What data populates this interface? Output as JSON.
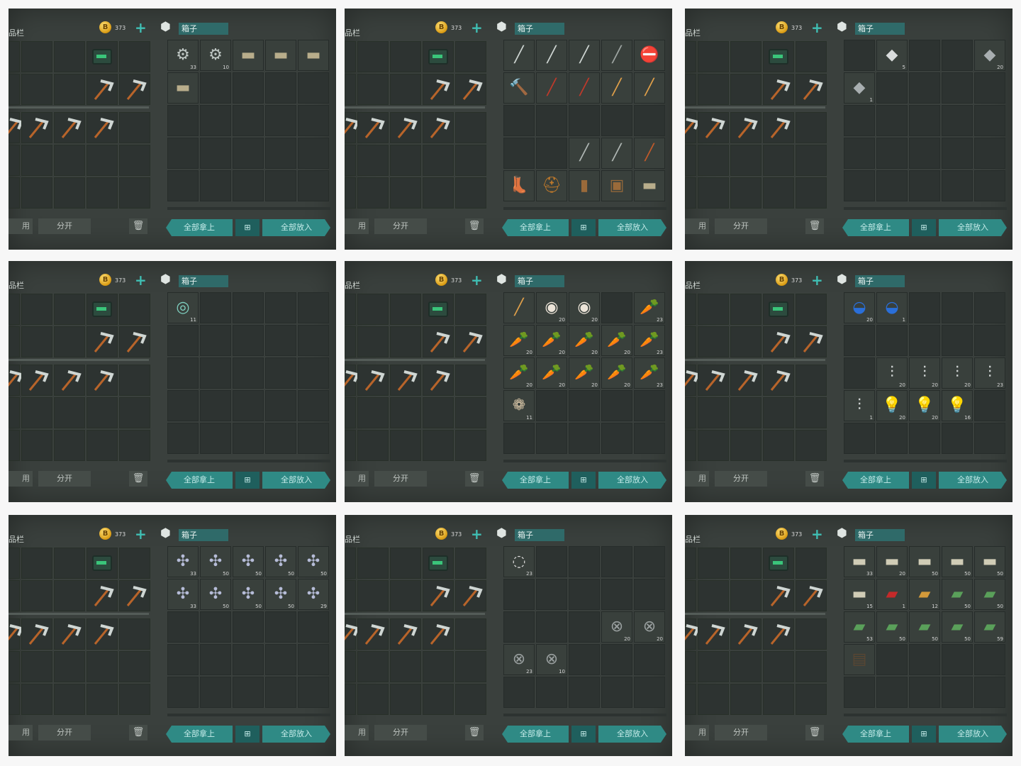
{
  "labels": {
    "inventory": "品栏",
    "coins": "373",
    "split": "分开",
    "use": "用",
    "box": "箱子",
    "take_all": "全部拿上",
    "put_all": "全部放入",
    "sort": "⊞",
    "trash": "🗑",
    "plus": "+"
  },
  "colors": {
    "accent": "#2f8a85",
    "panel": "#3a403d",
    "slot": "#2d3331"
  },
  "panels": [
    {
      "name": "box-tools",
      "slots": [
        {
          "icon": "⚙",
          "c": "#bfc7c4",
          "n": "33"
        },
        {
          "icon": "⚙",
          "c": "#bfc7c4",
          "n": "10"
        },
        {
          "icon": "▬",
          "c": "#b8ad8b",
          "n": ""
        },
        {
          "icon": "▬",
          "c": "#b8ad8b",
          "n": ""
        },
        {
          "icon": "▬",
          "c": "#b8ad8b",
          "n": ""
        },
        {
          "icon": "▬",
          "c": "#b8ad8b",
          "n": ""
        }
      ]
    },
    {
      "name": "box-weapons",
      "slots": [
        {
          "icon": "╱",
          "c": "#cfd6d3",
          "n": ""
        },
        {
          "icon": "╱",
          "c": "#cfd6d3",
          "n": ""
        },
        {
          "icon": "╱",
          "c": "#cfd6d3",
          "n": ""
        },
        {
          "icon": "╱",
          "c": "#9fa6a3",
          "n": ""
        },
        {
          "icon": "⛔",
          "c": "#d33",
          "n": ""
        },
        {
          "icon": "🔨",
          "c": "#4a90d9",
          "n": ""
        },
        {
          "icon": "╱",
          "c": "#c0392b",
          "n": ""
        },
        {
          "icon": "╱",
          "c": "#c0392b",
          "n": ""
        },
        {
          "icon": "╱",
          "c": "#e0a04a",
          "n": ""
        },
        {
          "icon": "╱",
          "c": "#e0a04a",
          "n": ""
        },
        {
          "icon": "",
          "c": "",
          "n": ""
        },
        {
          "icon": "",
          "c": "",
          "n": ""
        },
        {
          "icon": "",
          "c": "",
          "n": ""
        },
        {
          "icon": "",
          "c": "",
          "n": ""
        },
        {
          "icon": "",
          "c": "",
          "n": ""
        },
        {
          "icon": "",
          "c": "",
          "n": ""
        },
        {
          "icon": "",
          "c": "",
          "n": ""
        },
        {
          "icon": "╱",
          "c": "#b0b7b4",
          "n": ""
        },
        {
          "icon": "╱",
          "c": "#b0b7b4",
          "n": ""
        },
        {
          "icon": "╱",
          "c": "#c25a2a",
          "n": ""
        },
        {
          "icon": "👢",
          "c": "#b86a2a",
          "n": ""
        },
        {
          "icon": "⛑",
          "c": "#c27a2a",
          "n": ""
        },
        {
          "icon": "▮",
          "c": "#9a6a3a",
          "n": ""
        },
        {
          "icon": "▣",
          "c": "#9a6a3a",
          "n": ""
        },
        {
          "icon": "▬",
          "c": "#b8ad8b",
          "n": ""
        }
      ]
    },
    {
      "name": "box-metal",
      "slots": [
        {
          "icon": "",
          "c": "",
          "n": ""
        },
        {
          "icon": "◆",
          "c": "#d9dcdc",
          "n": "5"
        },
        {
          "icon": "",
          "c": "",
          "n": ""
        },
        {
          "icon": "",
          "c": "",
          "n": ""
        },
        {
          "icon": "◆",
          "c": "#a8aeb0",
          "n": "20"
        },
        {
          "icon": "◆",
          "c": "#a8aeb0",
          "n": "1"
        }
      ]
    },
    {
      "name": "box-wire",
      "slots": [
        {
          "icon": "◎",
          "c": "#7fd0c0",
          "n": "11"
        }
      ]
    },
    {
      "name": "box-carrots",
      "slots": [
        {
          "icon": "╱",
          "c": "#e0a04a",
          "n": ""
        },
        {
          "icon": "◉",
          "c": "#ece4d8",
          "n": "20"
        },
        {
          "icon": "◉",
          "c": "#ece4d8",
          "n": "20"
        },
        {
          "icon": "",
          "c": "",
          "n": ""
        },
        {
          "icon": "🥕",
          "c": "#e8742a",
          "n": "23"
        },
        {
          "icon": "🥕",
          "c": "#e8742a",
          "n": "20"
        },
        {
          "icon": "🥕",
          "c": "#e8742a",
          "n": "20"
        },
        {
          "icon": "🥕",
          "c": "#e8742a",
          "n": "20"
        },
        {
          "icon": "🥕",
          "c": "#e8742a",
          "n": "20"
        },
        {
          "icon": "🥕",
          "c": "#e8742a",
          "n": "23"
        },
        {
          "icon": "🥕",
          "c": "#e8742a",
          "n": "20"
        },
        {
          "icon": "🥕",
          "c": "#e8742a",
          "n": "20"
        },
        {
          "icon": "🥕",
          "c": "#e8742a",
          "n": "20"
        },
        {
          "icon": "🥕",
          "c": "#e8742a",
          "n": "20"
        },
        {
          "icon": "🥕",
          "c": "#e8742a",
          "n": "23"
        },
        {
          "icon": "❁",
          "c": "#d9c6a8",
          "n": "11"
        }
      ]
    },
    {
      "name": "box-electronics",
      "slots": [
        {
          "icon": "◒",
          "c": "#2a6fd9",
          "n": "20"
        },
        {
          "icon": "◒",
          "c": "#2a6fd9",
          "n": "1"
        },
        {
          "icon": "",
          "c": "",
          "n": ""
        },
        {
          "icon": "",
          "c": "",
          "n": ""
        },
        {
          "icon": "",
          "c": "",
          "n": ""
        },
        {
          "icon": "",
          "c": "",
          "n": ""
        },
        {
          "icon": "",
          "c": "",
          "n": ""
        },
        {
          "icon": "",
          "c": "",
          "n": ""
        },
        {
          "icon": "",
          "c": "",
          "n": ""
        },
        {
          "icon": "",
          "c": "",
          "n": ""
        },
        {
          "icon": "",
          "c": "",
          "n": ""
        },
        {
          "icon": "⫶",
          "c": "#cfd3d3",
          "n": "20"
        },
        {
          "icon": "⫶",
          "c": "#cfd3d3",
          "n": "20"
        },
        {
          "icon": "⫶",
          "c": "#cfd3d3",
          "n": "20"
        },
        {
          "icon": "⫶",
          "c": "#cfd3d3",
          "n": "23"
        },
        {
          "icon": "⫶",
          "c": "#cfd3d3",
          "n": "1"
        },
        {
          "icon": "💡",
          "c": "#cfd3d3",
          "n": "20"
        },
        {
          "icon": "💡",
          "c": "#cfd3d3",
          "n": "20"
        },
        {
          "icon": "💡",
          "c": "#cfd3d3",
          "n": "16"
        }
      ]
    },
    {
      "name": "box-scrap",
      "slots": [
        {
          "icon": "✣",
          "c": "#b6bcd8",
          "n": "33"
        },
        {
          "icon": "✣",
          "c": "#b6bcd8",
          "n": "50"
        },
        {
          "icon": "✣",
          "c": "#b6bcd8",
          "n": "50"
        },
        {
          "icon": "✣",
          "c": "#b6bcd8",
          "n": "50"
        },
        {
          "icon": "✣",
          "c": "#b6bcd8",
          "n": "50"
        },
        {
          "icon": "✣",
          "c": "#b6bcd8",
          "n": "33"
        },
        {
          "icon": "✣",
          "c": "#b6bcd8",
          "n": "50"
        },
        {
          "icon": "✣",
          "c": "#b6bcd8",
          "n": "50"
        },
        {
          "icon": "✣",
          "c": "#b6bcd8",
          "n": "50"
        },
        {
          "icon": "✣",
          "c": "#b6bcd8",
          "n": "29"
        }
      ]
    },
    {
      "name": "box-springs",
      "slots": [
        {
          "icon": "◌",
          "c": "#d8d8d8",
          "n": "23"
        },
        {
          "icon": "",
          "c": "",
          "n": ""
        },
        {
          "icon": "",
          "c": "",
          "n": ""
        },
        {
          "icon": "",
          "c": "",
          "n": ""
        },
        {
          "icon": "",
          "c": "",
          "n": ""
        },
        {
          "icon": "",
          "c": "",
          "n": ""
        },
        {
          "icon": "",
          "c": "",
          "n": ""
        },
        {
          "icon": "",
          "c": "",
          "n": ""
        },
        {
          "icon": "",
          "c": "",
          "n": ""
        },
        {
          "icon": "",
          "c": "",
          "n": ""
        },
        {
          "icon": "",
          "c": "",
          "n": ""
        },
        {
          "icon": "",
          "c": "",
          "n": ""
        },
        {
          "icon": "",
          "c": "",
          "n": ""
        },
        {
          "icon": "⊗",
          "c": "#9aa0a0",
          "n": "20"
        },
        {
          "icon": "⊗",
          "c": "#9aa0a0",
          "n": "20"
        },
        {
          "icon": "⊗",
          "c": "#9aa0a0",
          "n": "23"
        },
        {
          "icon": "⊗",
          "c": "#9aa0a0",
          "n": "10"
        }
      ]
    },
    {
      "name": "box-cloth",
      "slots": [
        {
          "icon": "▬",
          "c": "#d0ccb6",
          "n": "33"
        },
        {
          "icon": "▬",
          "c": "#d0ccb6",
          "n": "20"
        },
        {
          "icon": "▬",
          "c": "#d0ccb6",
          "n": "50"
        },
        {
          "icon": "▬",
          "c": "#d0ccb6",
          "n": "50"
        },
        {
          "icon": "▬",
          "c": "#d0ccb6",
          "n": "50"
        },
        {
          "icon": "▬",
          "c": "#d0ccb6",
          "n": "15"
        },
        {
          "icon": "▰",
          "c": "#c42a2a",
          "n": "1"
        },
        {
          "icon": "▰",
          "c": "#d39a3a",
          "n": "12"
        },
        {
          "icon": "▰",
          "c": "#5aa05a",
          "n": "50"
        },
        {
          "icon": "▰",
          "c": "#5aa05a",
          "n": "50"
        },
        {
          "icon": "▰",
          "c": "#5aa05a",
          "n": "53"
        },
        {
          "icon": "▰",
          "c": "#5aa05a",
          "n": "50"
        },
        {
          "icon": "▰",
          "c": "#5aa05a",
          "n": "50"
        },
        {
          "icon": "▰",
          "c": "#5aa05a",
          "n": "50"
        },
        {
          "icon": "▰",
          "c": "#5aa05a",
          "n": "59"
        },
        {
          "icon": "▤",
          "c": "#5a4632",
          "n": ""
        }
      ]
    }
  ]
}
